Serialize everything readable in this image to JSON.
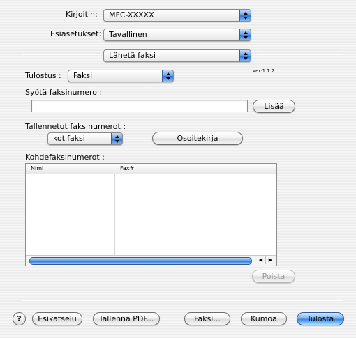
{
  "printer": {
    "label": "Kirjoitin:",
    "value": "MFC-XXXXX"
  },
  "presets": {
    "label": "Esiasetukset:",
    "value": "Tavallinen"
  },
  "panel": {
    "value": "Lähetä faksi"
  },
  "version": "ver:1.1.2",
  "output": {
    "label": "Tulostus :",
    "value": "Faksi"
  },
  "fax_entry": {
    "label": "Syötä faksinumero :",
    "value": "",
    "add_button": "Lisää"
  },
  "stored": {
    "label": "Tallennetut faksinumerot :",
    "value": "kotifaksi",
    "addressbook_button": "Osoitekirja"
  },
  "destinations": {
    "label": "Kohdefaksinumerot :",
    "columns": [
      "Nimi",
      "Fax#"
    ],
    "rows": [],
    "delete_button": "Poista"
  },
  "footer": {
    "help": "?",
    "preview": "Esikatselu",
    "save_pdf": "Tallenna PDF...",
    "fax": "Faksi...",
    "cancel": "Kumoa",
    "print": "Tulosta"
  }
}
